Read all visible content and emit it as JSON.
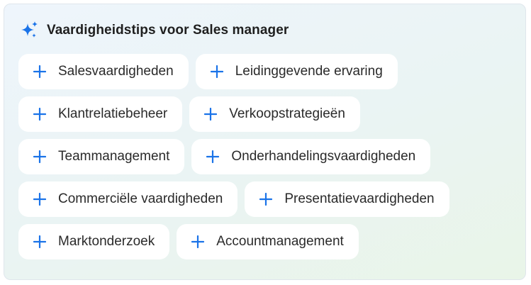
{
  "panel": {
    "title": "Vaardigheidstips voor Sales manager",
    "icon": "sparkle-icon",
    "accent_color": "#1a73e8"
  },
  "chip_rows": [
    [
      {
        "label": "Salesvaardigheden"
      },
      {
        "label": "Leidinggevende ervaring"
      }
    ],
    [
      {
        "label": "Klantrelatiebeheer"
      },
      {
        "label": "Verkoopstrategieën"
      }
    ],
    [
      {
        "label": "Teammanagement"
      },
      {
        "label": "Onderhandelingsvaardigheden"
      }
    ],
    [
      {
        "label": "Commerciële vaardigheden"
      },
      {
        "label": "Presentatievaardigheden"
      }
    ],
    [
      {
        "label": "Marktonderzoek"
      },
      {
        "label": "Accountmanagement"
      }
    ]
  ]
}
